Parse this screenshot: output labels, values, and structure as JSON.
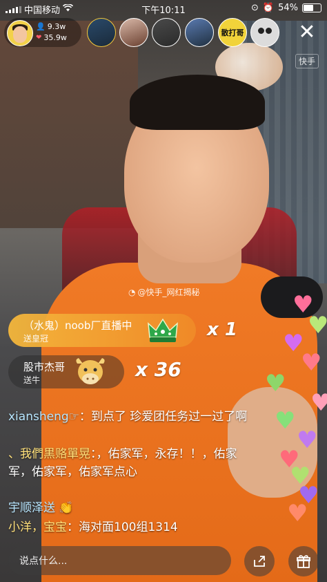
{
  "status_bar": {
    "carrier": "中国移动",
    "time": "下午10:11",
    "battery": "54%"
  },
  "host": {
    "stat_people": "9.3w",
    "stat_likes": "35.9w"
  },
  "viewers": [
    {
      "label": ""
    },
    {
      "label": ""
    },
    {
      "label": ""
    },
    {
      "label": ""
    },
    {
      "label": "散打哥"
    },
    {
      "label": ""
    }
  ],
  "corner_tag": "快手",
  "watermark": "@快手_网红揭秘",
  "gifts": [
    {
      "title": "（水鬼）noob厂直播中",
      "subtitle": "送皇冠",
      "multiplier": "x 1"
    },
    {
      "title": "股市杰哥",
      "subtitle": "送牛",
      "multiplier": "x 36"
    }
  ],
  "chat": [
    {
      "name": "xiansheng",
      "name_suffix": "☞",
      "text": "：到点了  珍爱团任务过一过了啊"
    },
    {
      "name": "、我們黒赂單晃",
      "name_suffix": "",
      "text": "：，佑家军，永存！！，佑家军，佑家军，佑家军点心"
    },
    {
      "name": "宇顺泽送",
      "name_suffix": "",
      "text": ""
    },
    {
      "name": "小洋，宝宝",
      "name_suffix": "",
      "text": "：海对面100组1314"
    }
  ],
  "comment_placeholder": "说点什么...",
  "heart_colors": [
    "#ff6f9a",
    "#b9e87a",
    "#d46cf0",
    "#ff7a8a",
    "#8ed66a",
    "#ffa0b8",
    "#86e07a",
    "#c07af0",
    "#ff6a7a",
    "#b0e070",
    "#a06af0",
    "#ff8a6a"
  ]
}
